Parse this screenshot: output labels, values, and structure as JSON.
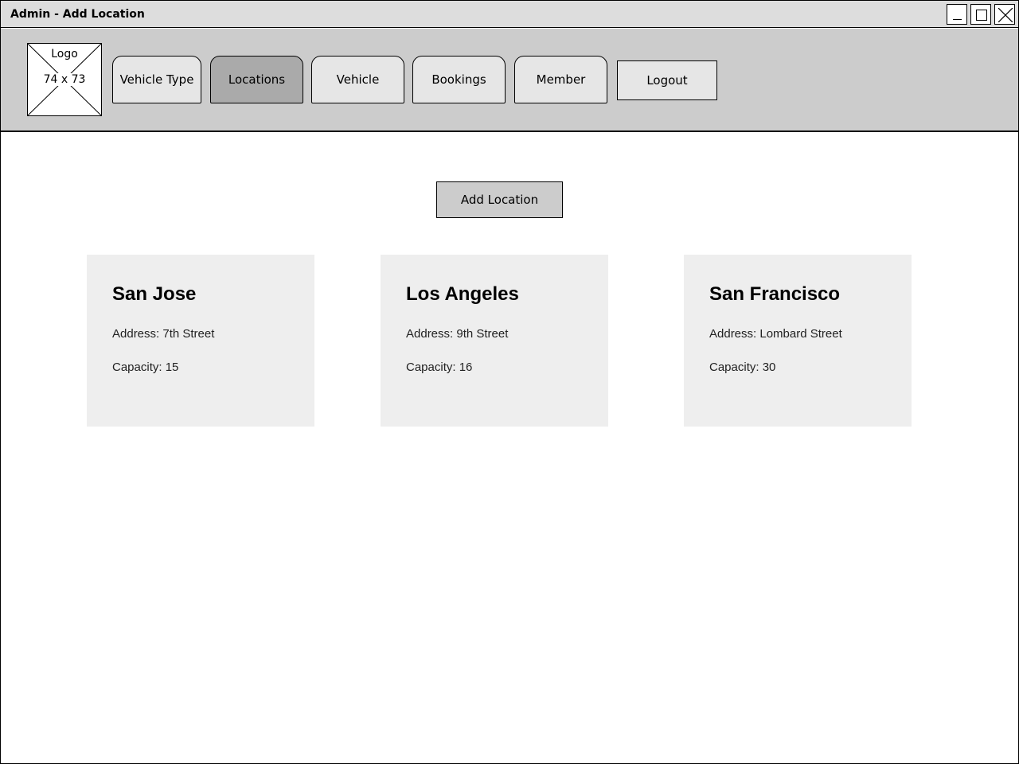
{
  "window": {
    "title": "Admin - Add Location"
  },
  "logo": {
    "label": "Logo",
    "size_text": "74 x 73"
  },
  "nav": {
    "tabs": [
      {
        "label": "Vehicle Type",
        "active": false
      },
      {
        "label": "Locations",
        "active": true
      },
      {
        "label": "Vehicle",
        "active": false
      },
      {
        "label": "Bookings",
        "active": false
      },
      {
        "label": "Member",
        "active": false
      }
    ],
    "logout_label": "Logout"
  },
  "main": {
    "add_button_label": "Add Location",
    "locations": [
      {
        "name": "San Jose",
        "address": "Address: 7th Street",
        "capacity": "Capacity: 15"
      },
      {
        "name": "Los Angeles",
        "address": "Address: 9th Street",
        "capacity": "Capacity: 16"
      },
      {
        "name": "San Francisco",
        "address": "Address: Lombard Street",
        "capacity": "Capacity: 30"
      }
    ]
  },
  "colors": {
    "titlebar_bg": "#dddddd",
    "navbar_bg": "#cccccc",
    "tab_bg": "#e6e6e6",
    "tab_active_bg": "#aaaaaa",
    "card_bg": "#eeeeee"
  },
  "icons": [
    "minimize-icon",
    "maximize-icon",
    "close-icon",
    "image-placeholder-icon"
  ]
}
